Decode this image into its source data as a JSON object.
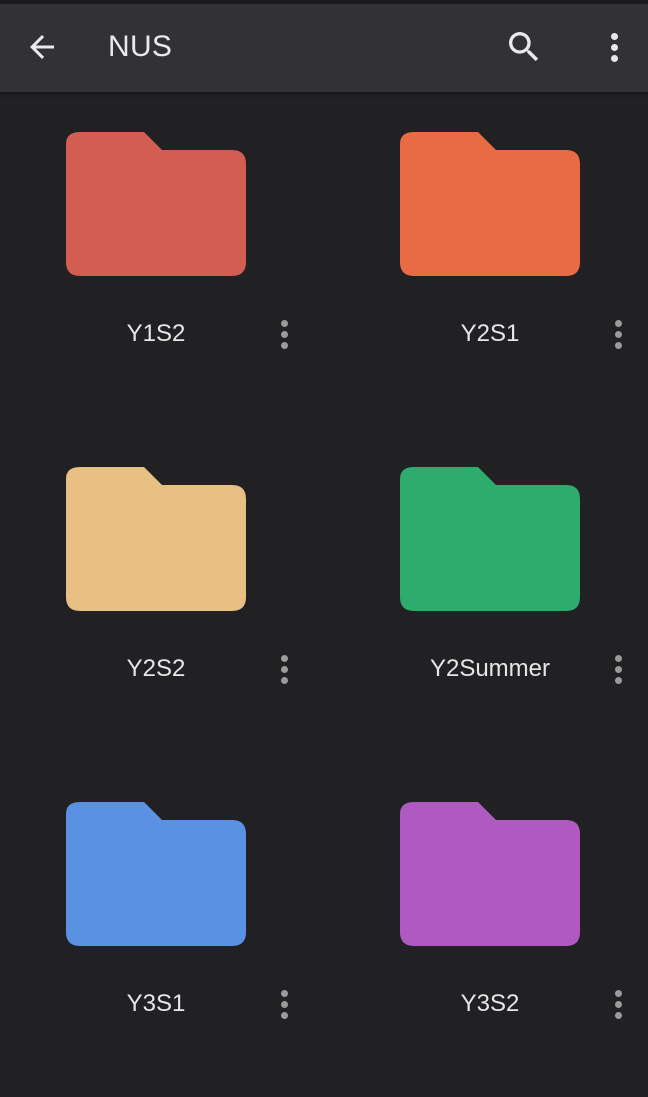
{
  "app_bar": {
    "title": "NUS",
    "back_icon": "arrow-back-icon",
    "search_icon": "search-icon",
    "more_icon": "more-vert-icon"
  },
  "folders": [
    {
      "name": "Y1S2",
      "color": "#D35D51"
    },
    {
      "name": "Y2S1",
      "color": "#E86B44"
    },
    {
      "name": "Y2S2",
      "color": "#E8C084"
    },
    {
      "name": "Y2Summer",
      "color": "#2EAC6D"
    },
    {
      "name": "Y3S1",
      "color": "#5A91E2"
    },
    {
      "name": "Y3S2",
      "color": "#AE5AC0"
    }
  ],
  "colors": {
    "background": "#212124",
    "app_bar": "#323236",
    "text": "#E6E6E6"
  }
}
